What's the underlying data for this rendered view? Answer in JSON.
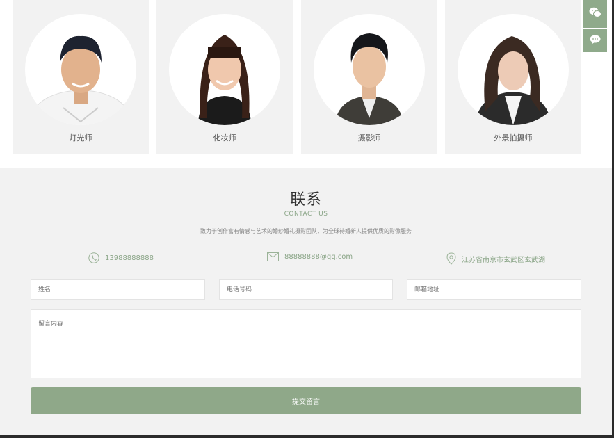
{
  "team": {
    "members": [
      {
        "name": "灯光师"
      },
      {
        "name": "化妆师"
      },
      {
        "name": "摄影师"
      },
      {
        "name": "外景拍摄师"
      }
    ]
  },
  "side_icons": [
    {
      "icon": "wechat-icon"
    },
    {
      "icon": "message-icon"
    }
  ],
  "contact": {
    "title": "联系",
    "subtitle": "CONTACT US",
    "description": "致力于创作富有情感与艺术的婚纱婚礼摄影团队，为全球待婚新人提供优质的影像服务",
    "phone": "13988888888",
    "email": "88888888@qq.com",
    "address": "江苏省南京市玄武区玄武湖"
  },
  "form": {
    "name_placeholder": "姓名",
    "phone_placeholder": "电话号码",
    "email_placeholder": "邮箱地址",
    "message_placeholder": "留言内容",
    "submit_label": "提交留言"
  },
  "colors": {
    "accent": "#8fa889",
    "section_bg": "#f2f2f2"
  }
}
